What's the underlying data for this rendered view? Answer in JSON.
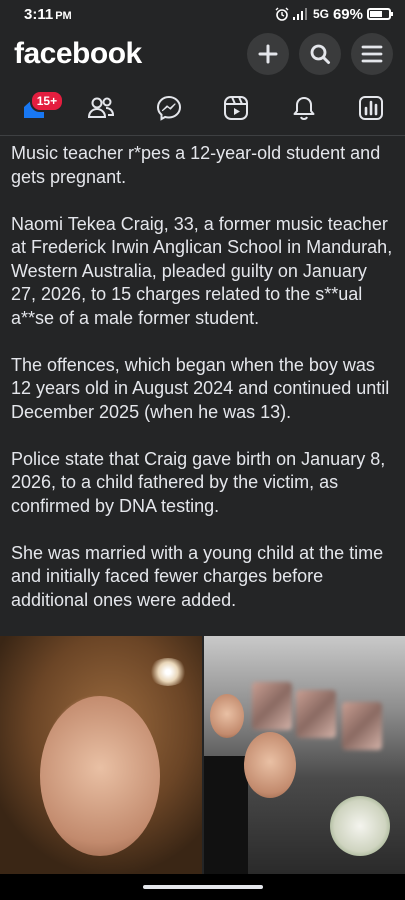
{
  "status_bar": {
    "time": "3:11",
    "ampm": "PM",
    "network": "5G",
    "battery_percent": "69%",
    "battery_level": 0.69
  },
  "header": {
    "logo": "facebook",
    "buttons": [
      {
        "name": "create",
        "icon": "plus-icon"
      },
      {
        "name": "search",
        "icon": "search-icon"
      },
      {
        "name": "menu",
        "icon": "menu-icon"
      }
    ]
  },
  "nav": {
    "home_badge": "15+",
    "items": [
      "home-icon",
      "friends-icon",
      "messenger-icon",
      "reels-icon",
      "notifications-icon",
      "dashboard-icon"
    ]
  },
  "post": {
    "paragraphs": [
      "Music teacher r*pes a 12-year-old student and gets pregnant.",
      "Naomi Tekea Craig, 33, a former music teacher at Frederick Irwin Anglican School in Mandurah, Western Australia, pleaded guilty on January 27, 2026, to 15 charges related to the s**ual a**se of a male former student.",
      "The offences, which began when the boy was 12 years old in August 2024 and continued until December 2025 (when he was 13).",
      "Police state that Craig gave birth on January 8, 2026, to a child fathered by the victim, as confirmed by DNA testing.",
      "She was married with a young child at the time and initially faced fewer charges before additional ones were added."
    ]
  },
  "colors": {
    "background": "#242526",
    "text": "#e4e6eb",
    "badge": "#e41e3f",
    "icon_active": "#1877f2"
  }
}
